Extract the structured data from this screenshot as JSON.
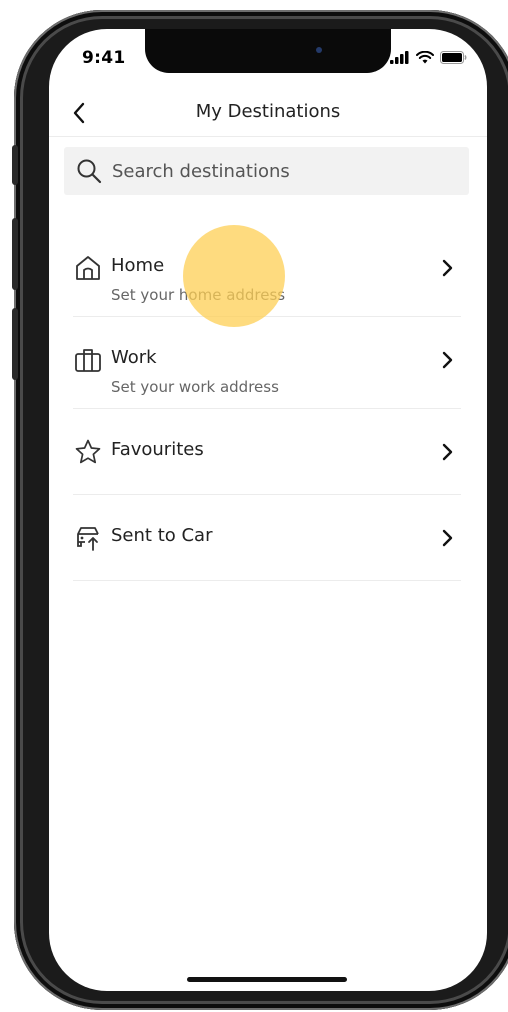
{
  "status_bar": {
    "time": "9:41",
    "icons": [
      "signal-icon",
      "wifi-icon",
      "battery-icon"
    ]
  },
  "nav": {
    "back_icon": "chevron-left-icon",
    "title": "My Destinations"
  },
  "search": {
    "icon": "search-icon",
    "placeholder": "Search destinations"
  },
  "destinations": [
    {
      "icon": "home-icon",
      "title": "Home",
      "subtitle": "Set your home address"
    },
    {
      "icon": "briefcase-icon",
      "title": "Work",
      "subtitle": "Set your work address"
    },
    {
      "icon": "star-icon",
      "title": "Favourites",
      "subtitle": ""
    },
    {
      "icon": "car-upload-icon",
      "title": "Sent to Car",
      "subtitle": ""
    }
  ],
  "colors": {
    "touch_indicator": "#fdcf54",
    "text_primary": "#222222",
    "text_secondary": "#666666",
    "search_background": "#f2f2f2"
  }
}
